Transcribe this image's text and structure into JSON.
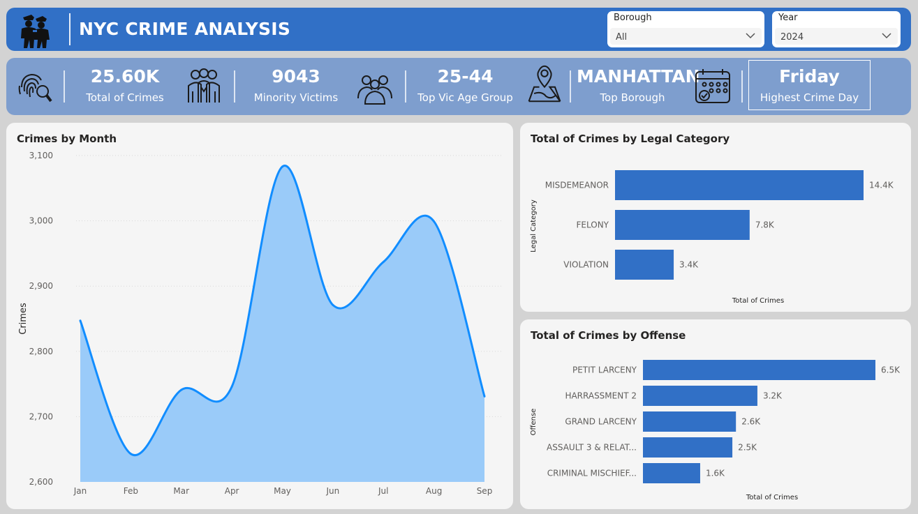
{
  "header": {
    "title": "NYC CRIME ANALYSIS",
    "icon": "police-officers-icon"
  },
  "filters": {
    "borough": {
      "label": "Borough",
      "value": "All"
    },
    "year": {
      "label": "Year",
      "value": "2024"
    }
  },
  "kpis": [
    {
      "value": "25.60K",
      "label": "Total of Crimes",
      "icon": "fingerprint-search-icon"
    },
    {
      "value": "9043",
      "label": "Minority Victims",
      "icon": "group-people-icon"
    },
    {
      "value": "25-44",
      "label": "Top Vic Age Group",
      "icon": "three-people-icon"
    },
    {
      "value": "MANHATTAN",
      "label": "Top Borough",
      "icon": "map-location-icon"
    },
    {
      "value": "Friday",
      "label": "Highest Crime Day",
      "icon": "calendar-check-icon"
    }
  ],
  "colors": {
    "header": "#3170c6",
    "kpi_bar": "#7e9ece",
    "line": "#118dff",
    "area": "#9acbf9",
    "bar": "#3170c6",
    "card": "#f5f5f5"
  },
  "chart_data": [
    {
      "type": "area",
      "title": "Crimes by Month",
      "xlabel": "",
      "ylabel": "Crimes",
      "categories": [
        "Jan",
        "Feb",
        "Mar",
        "Apr",
        "May",
        "Jun",
        "Jul",
        "Aug",
        "Sep"
      ],
      "values": [
        2847,
        2643,
        2741,
        2746,
        3083,
        2871,
        2937,
        2999,
        2731
      ],
      "ylim": [
        2600,
        3100
      ],
      "yticks": [
        "2,600",
        "2,700",
        "2,800",
        "2,900",
        "3,000",
        "3,100"
      ],
      "ytick_values": [
        2600,
        2700,
        2800,
        2900,
        3000,
        3100
      ],
      "grid": true,
      "smooth": true
    },
    {
      "type": "bar",
      "orientation": "horizontal",
      "title": "Total of Crimes by Legal Category",
      "xlabel": "Total of Crimes",
      "ylabel": "Legal Category",
      "categories": [
        "MISDEMEANOR",
        "FELONY",
        "VIOLATION"
      ],
      "values": [
        14.4,
        7.8,
        3.4
      ],
      "labels": [
        "14.4K",
        "7.8K",
        "3.4K"
      ],
      "unit": "thousands"
    },
    {
      "type": "bar",
      "orientation": "horizontal",
      "title": "Total of Crimes by Offense",
      "xlabel": "Total of Crimes",
      "ylabel": "Offense",
      "categories": [
        "PETIT LARCENY",
        "HARRASSMENT 2",
        "GRAND LARCENY",
        "ASSAULT 3 & RELAT...",
        "CRIMINAL MISCHIEF..."
      ],
      "values": [
        6.5,
        3.2,
        2.6,
        2.5,
        1.6
      ],
      "labels": [
        "6.5K",
        "3.2K",
        "2.6K",
        "2.5K",
        "1.6K"
      ],
      "unit": "thousands"
    }
  ]
}
